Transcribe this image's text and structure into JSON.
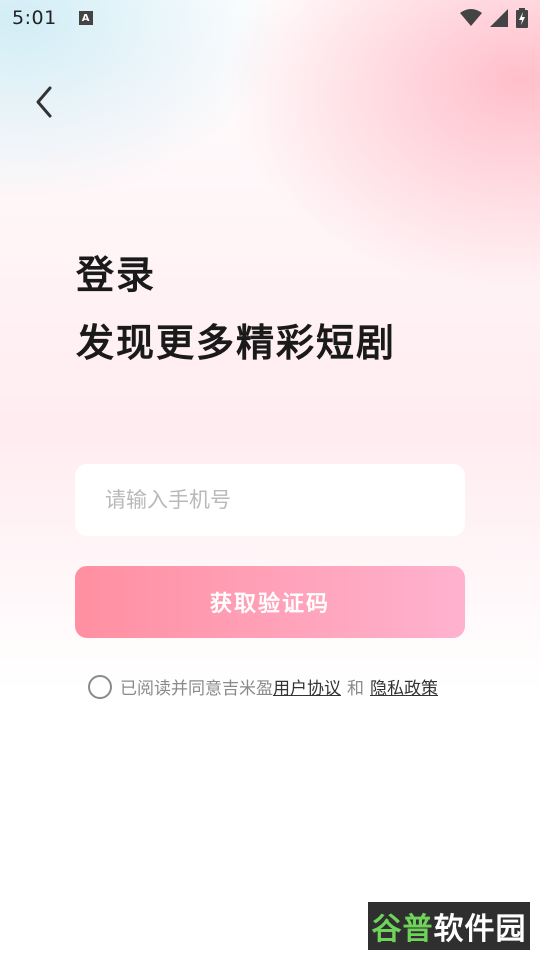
{
  "status_bar": {
    "time": "5:01",
    "notification_icon": "A",
    "icons": [
      "wifi-icon",
      "signal-icon",
      "battery-charging-icon"
    ]
  },
  "nav": {
    "back_icon": "chevron-left-icon"
  },
  "header": {
    "title": "登录",
    "subtitle": "发现更多精彩短剧"
  },
  "form": {
    "phone_placeholder": "请输入手机号",
    "phone_value": "",
    "get_code_label": "获取验证码"
  },
  "agreement": {
    "prefix": "已阅读并同意吉米盈",
    "user_agreement": "用户协议",
    "and": "和",
    "privacy_policy": "隐私政策",
    "checked": false
  },
  "watermark": {
    "part1": "谷普",
    "part2": "软件园"
  },
  "colors": {
    "button_gradient_start": "#ff8fa1",
    "button_gradient_end": "#ffb2cf",
    "title_text": "#1a1a1a"
  }
}
